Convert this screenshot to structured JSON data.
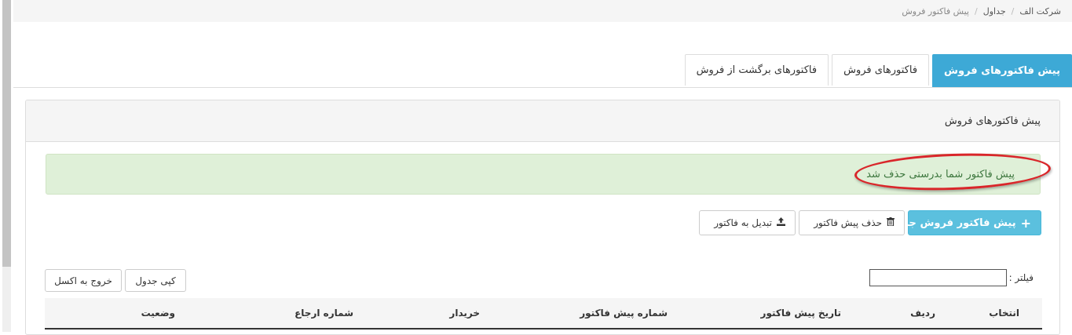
{
  "breadcrumb": {
    "items": [
      "شرکت الف",
      "جداول",
      "پیش فاکتور فروش"
    ],
    "separator": "/"
  },
  "tabs": [
    {
      "label": "پیش فاکتورهای فروش",
      "active": true
    },
    {
      "label": "فاکتورهای فروش",
      "active": false
    },
    {
      "label": "فاکتورهای برگشت از فروش",
      "active": false
    }
  ],
  "panel": {
    "title": "پیش فاکتورهای فروش",
    "alert": "پیش فاکتور شما بدرستی حذف شد"
  },
  "toolbar": {
    "new_label": "پیش فاکتور فروش جدید",
    "new_icon": "+",
    "delete_label": "حذف پیش فاکتور",
    "delete_icon": "trash-icon",
    "convert_label": "تبدیل به فاکتور",
    "convert_icon": "upload-icon"
  },
  "filter": {
    "label": "فیلتر :",
    "value": ""
  },
  "export": {
    "copy_label": "کپی جدول",
    "excel_label": "خروج به اکسل"
  },
  "table": {
    "columns": [
      "انتخاب",
      "ردیف",
      "تاریخ پیش فاکتور",
      "شماره پیش فاکتور",
      "خریدار",
      "شماره ارجاع",
      "وضعیت"
    ]
  },
  "colors": {
    "accent": "#3da9d6",
    "info_button": "#5bc0de",
    "success_bg": "#dff0d8",
    "success_text": "#3c763d",
    "annotation": "#d9262a"
  }
}
